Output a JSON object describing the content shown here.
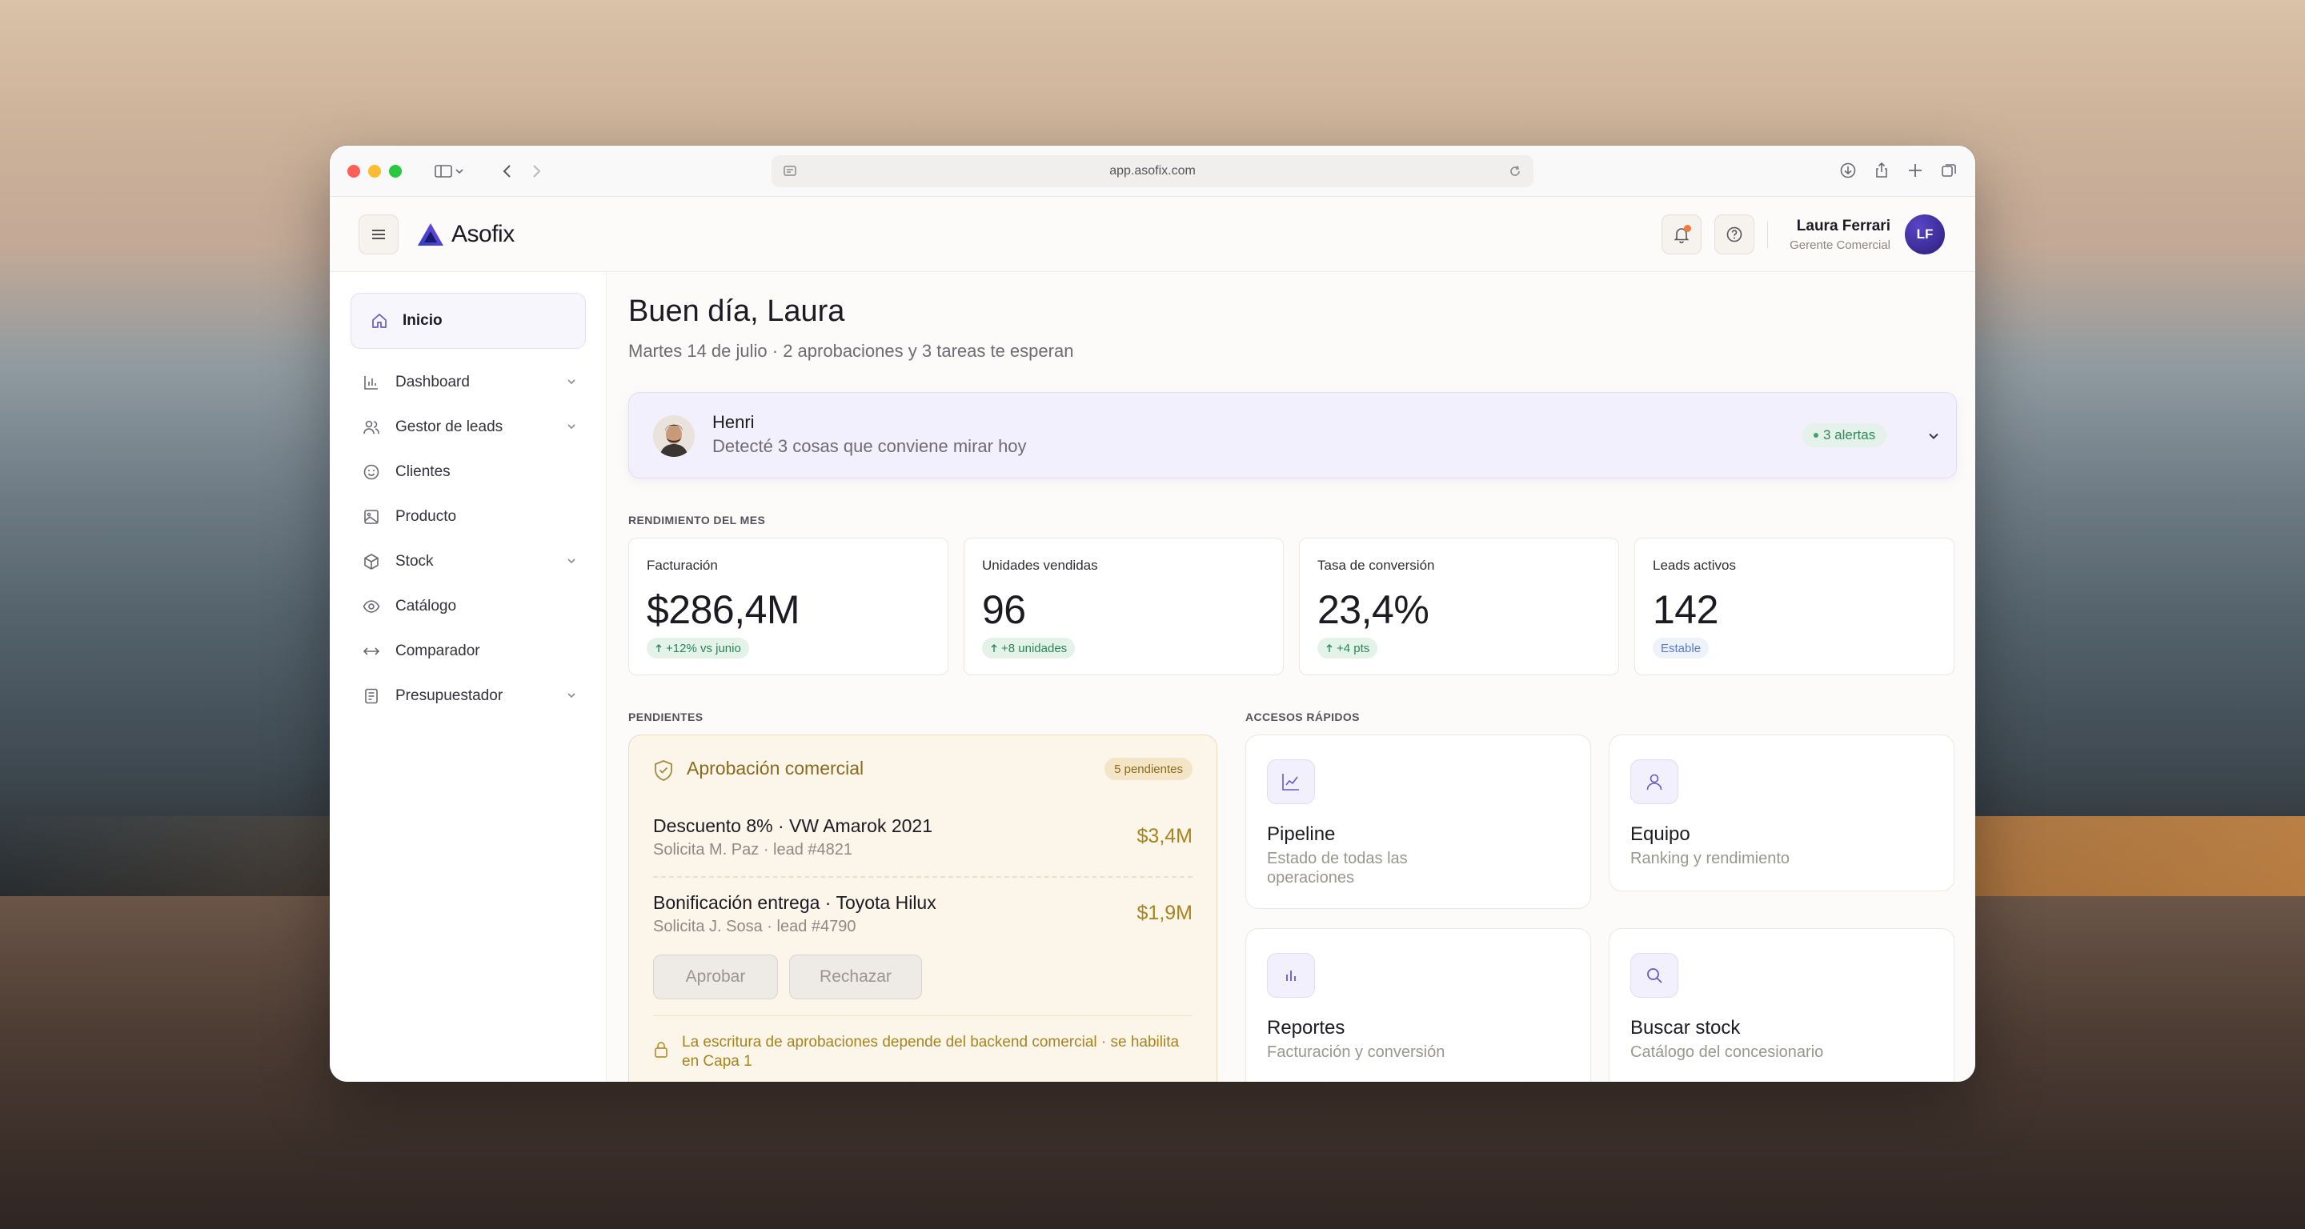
{
  "browser": {
    "url": "app.asofix.com"
  },
  "app": {
    "brand": "Asofix",
    "user": {
      "name": "Laura Ferrari",
      "role": "Gerente Comercial",
      "initials": "LF"
    }
  },
  "sidebar": {
    "active": "Inicio",
    "items": [
      {
        "label": "Dashboard",
        "icon": "bar-chart-icon",
        "expandable": true
      },
      {
        "label": "Gestor de leads",
        "icon": "users-icon",
        "expandable": true
      },
      {
        "label": "Clientes",
        "icon": "smile-icon",
        "expandable": false
      },
      {
        "label": "Producto",
        "icon": "image-icon",
        "expandable": false
      },
      {
        "label": "Stock",
        "icon": "box-icon",
        "expandable": true
      },
      {
        "label": "Catálogo",
        "icon": "eye-icon",
        "expandable": false
      },
      {
        "label": "Comparador",
        "icon": "arrows-icon",
        "expandable": false
      },
      {
        "label": "Presupuestador",
        "icon": "document-icon",
        "expandable": true
      }
    ]
  },
  "main": {
    "greeting": "Buen día, Laura",
    "subtitle": "Martes 14 de julio · 2 aprobaciones y 3 tareas te esperan",
    "assistant": {
      "name": "Henri",
      "message": "Detecté 3 cosas que conviene mirar hoy",
      "alerts": "3 alertas"
    },
    "kpi_section": "RENDIMIENTO DEL MES",
    "kpis": [
      {
        "label": "Facturación",
        "value": "$286,4M",
        "badge": "+12% vs junio",
        "trend": "up"
      },
      {
        "label": "Unidades vendidas",
        "value": "96",
        "badge": "+8 unidades",
        "trend": "up"
      },
      {
        "label": "Tasa de conversión",
        "value": "23,4%",
        "badge": "+4 pts",
        "trend": "up"
      },
      {
        "label": "Leads activos",
        "value": "142",
        "badge": "Estable",
        "trend": "flat"
      }
    ],
    "pending_section": "PENDIENTES",
    "approval": {
      "title": "Aprobación comercial",
      "count": "5 pendientes",
      "rows": [
        {
          "title": "Descuento 8% · VW Amarok 2021",
          "sub": "Solicita M. Paz · lead #4821",
          "amount": "$3,4M"
        },
        {
          "title": "Bonificación entrega · Toyota Hilux",
          "sub": "Solicita J. Sosa · lead #4790",
          "amount": "$1,9M"
        }
      ],
      "approve": "Aprobar",
      "reject": "Rechazar",
      "note": "La escritura de aprobaciones depende del backend comercial · se habilita en Capa 1"
    },
    "quick_section": "ACCESOS RÁPIDOS",
    "quick": [
      {
        "title": "Pipeline",
        "sub": "Estado de todas las operaciones",
        "icon": "line-chart-icon"
      },
      {
        "title": "Equipo",
        "sub": "Ranking y rendimiento",
        "icon": "person-icon"
      },
      {
        "title": "Reportes",
        "sub": "Facturación y conversión",
        "icon": "bar-chart-icon"
      },
      {
        "title": "Buscar stock",
        "sub": "Catálogo del concesionario",
        "icon": "search-icon"
      }
    ]
  },
  "colors": {
    "accent": "#6a56c8",
    "success": "#2c8454",
    "warning": "#a8841e",
    "notification": "#f07a3a"
  }
}
